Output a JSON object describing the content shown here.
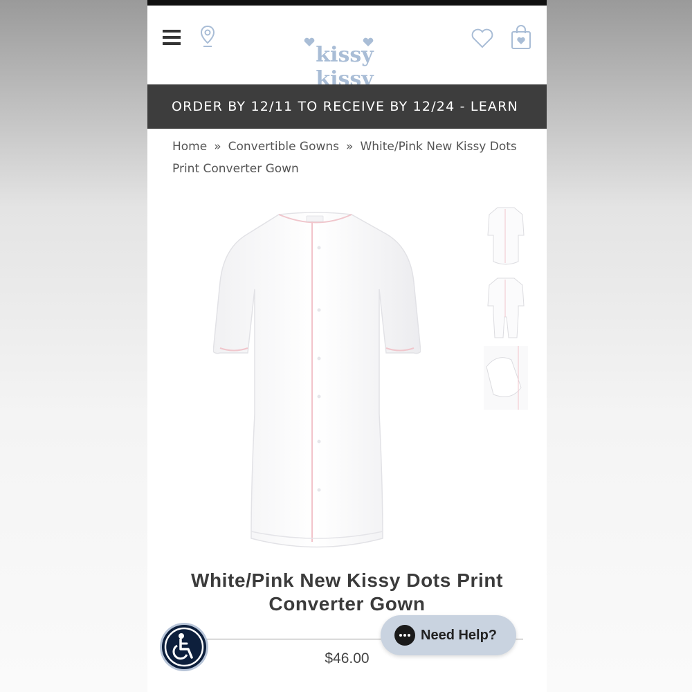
{
  "header": {
    "brand": "kissy kissy",
    "icons": [
      "menu-icon",
      "location-pin-icon",
      "wishlist-heart-icon",
      "shopping-bag-icon"
    ]
  },
  "promo": {
    "text": "ORDER BY 12/11 TO RECEIVE BY 12/24 - LEARN"
  },
  "breadcrumb": {
    "items": [
      "Home",
      "Convertible Gowns",
      "White/Pink New Kissy Dots Print Converter Gown"
    ],
    "separator": "»"
  },
  "product": {
    "title": "White/Pink New Kissy Dots Print Converter Gown",
    "price": "$46.00"
  },
  "widgets": {
    "help_label": "Need Help?"
  },
  "colors": {
    "brand_blue": "#a9bdd6",
    "promo_bg": "#3d3d3d",
    "accessibility_bg": "#0d1f3c",
    "help_bg": "#c9d3e0"
  }
}
